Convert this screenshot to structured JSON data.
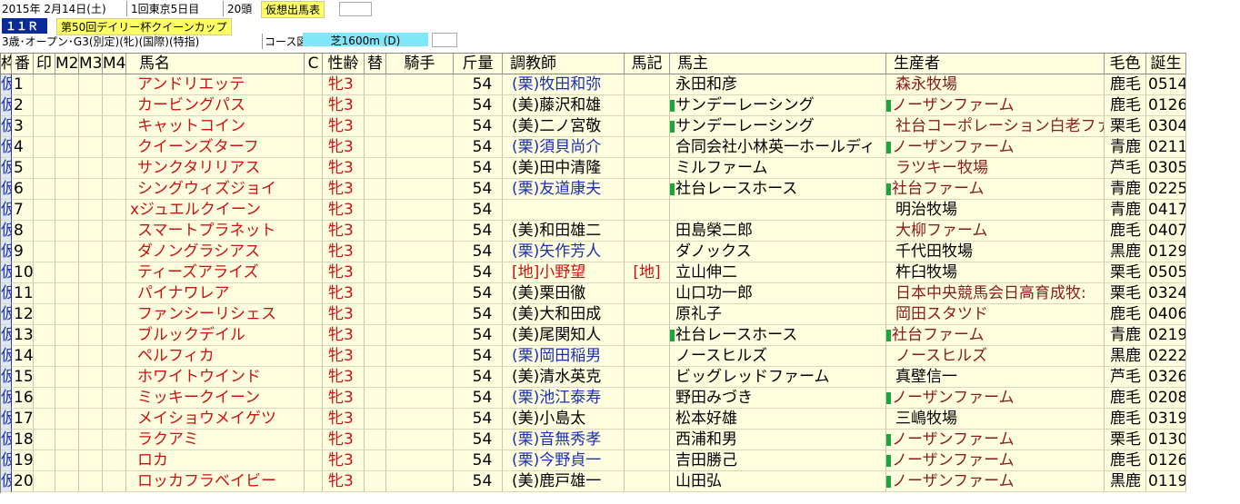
{
  "header": {
    "date": "2015年 2月14日(土)",
    "meeting": "1回東京5日目",
    "runners": "20頭",
    "mode_button": "仮想出馬表",
    "race_no": "１１Ｒ",
    "race_name": "第50回デイリー杯クイーンカップ",
    "conditions": "3歳･オープン･G3(別定)(牝)(国際)(特指)",
    "course_label": "コース図",
    "course": "芝1600m (D)"
  },
  "columns": [
    "枠",
    "番",
    "印",
    "M2",
    "M3",
    "M4",
    "馬名",
    "C",
    "性齢",
    "替",
    "騎手",
    "斤量",
    "調教師",
    "馬記",
    "馬主",
    "生産者",
    "毛色",
    "誕生"
  ],
  "colors": {
    "grid_bg": "#ffffe0",
    "female": "#cc1111",
    "ritto": "#1b2fb0",
    "mark_green": "#19a63a"
  },
  "rows": [
    {
      "waku": "仮",
      "no": "1",
      "name": "アンドリエッテ",
      "sex": "牝3",
      "weight": "54",
      "trainer": "(栗)牧田和弥",
      "trainer_c": "blu",
      "owner": "永田和彦",
      "owner_mark": false,
      "breeder": "森永牧場",
      "breeder_mark": false,
      "breeder_c": "brn",
      "coat": "鹿毛",
      "birth": "0514"
    },
    {
      "waku": "仮",
      "no": "2",
      "name": "カービングパス",
      "sex": "牝3",
      "weight": "54",
      "trainer": "(美)藤沢和雄",
      "trainer_c": "",
      "owner": "サンデーレーシング",
      "owner_mark": true,
      "breeder": "ノーザンファーム",
      "breeder_mark": true,
      "breeder_c": "brn",
      "coat": "鹿毛",
      "birth": "0126"
    },
    {
      "waku": "仮",
      "no": "3",
      "name": "キャットコイン",
      "sex": "牝3",
      "weight": "54",
      "trainer": "(美)二ノ宮敬",
      "trainer_c": "",
      "owner": "サンデーレーシング",
      "owner_mark": true,
      "breeder": "社台コーポレーション白老ファー",
      "breeder_mark": false,
      "breeder_c": "brn",
      "coat": "栗毛",
      "birth": "0304"
    },
    {
      "waku": "仮",
      "no": "4",
      "name": "クイーンズターフ",
      "sex": "牝3",
      "weight": "54",
      "trainer": "(栗)須貝尚介",
      "trainer_c": "blu",
      "owner": "合同会社小林英一ホールディ",
      "owner_mark": false,
      "breeder": "ノーザンファーム",
      "breeder_mark": true,
      "breeder_c": "brn",
      "coat": "青鹿",
      "birth": "0211"
    },
    {
      "waku": "仮",
      "no": "5",
      "name": "サンクタリリアス",
      "sex": "牝3",
      "weight": "54",
      "trainer": "(美)田中清隆",
      "trainer_c": "",
      "owner": "ミルファーム",
      "owner_mark": false,
      "breeder": "ラツキー牧場",
      "breeder_mark": false,
      "breeder_c": "brn",
      "coat": "芦毛",
      "birth": "0305"
    },
    {
      "waku": "仮",
      "no": "6",
      "name": "シングウィズジョイ",
      "sex": "牝3",
      "weight": "54",
      "trainer": "(栗)友道康夫",
      "trainer_c": "blu",
      "owner": "社台レースホース",
      "owner_mark": true,
      "breeder": "社台ファーム",
      "breeder_mark": true,
      "breeder_c": "brn",
      "coat": "青鹿",
      "birth": "0225"
    },
    {
      "waku": "仮",
      "no": "7",
      "name": "xジュエルクイーン",
      "sex": "牝3",
      "weight": "54",
      "trainer": "",
      "trainer_c": "",
      "owner": "",
      "owner_mark": false,
      "breeder": "明治牧場",
      "breeder_mark": false,
      "breeder_c": "",
      "coat": "青鹿",
      "birth": "0417"
    },
    {
      "waku": "仮",
      "no": "8",
      "name": "スマートプラネット",
      "sex": "牝3",
      "weight": "54",
      "trainer": "(美)和田雄二",
      "trainer_c": "",
      "owner": "田島榮二郎",
      "owner_mark": false,
      "breeder": "大柳ファーム",
      "breeder_mark": false,
      "breeder_c": "brn",
      "coat": "鹿毛",
      "birth": "0407"
    },
    {
      "waku": "仮",
      "no": "9",
      "name": "ダノングラシアス",
      "sex": "牝3",
      "weight": "54",
      "trainer": "(栗)矢作芳人",
      "trainer_c": "blu",
      "owner": "ダノックス",
      "owner_mark": false,
      "breeder": "千代田牧場",
      "breeder_mark": false,
      "breeder_c": "",
      "coat": "黒鹿",
      "birth": "0129"
    },
    {
      "waku": "仮",
      "no": "10",
      "name": "ティーズアライズ",
      "sex": "牝3",
      "weight": "54",
      "trainer": "[地]小野望",
      "trainer_c": "red",
      "owner": "立山伸二",
      "owner_mark": false,
      "breeder": "杵臼牧場",
      "breeder_mark": false,
      "breeder_c": "",
      "coat": "栗毛",
      "birth": "0505",
      "umaki": "[地]"
    },
    {
      "waku": "仮",
      "no": "11",
      "name": "パイナワレア",
      "sex": "牝3",
      "weight": "54",
      "trainer": "(美)栗田徹",
      "trainer_c": "",
      "owner": "山口功一郎",
      "owner_mark": false,
      "breeder": "日本中央競馬会日高育成牧:",
      "breeder_mark": false,
      "breeder_c": "brn",
      "coat": "栗毛",
      "birth": "0324"
    },
    {
      "waku": "仮",
      "no": "12",
      "name": "ファンシーリシェス",
      "sex": "牝3",
      "weight": "54",
      "trainer": "(美)大和田成",
      "trainer_c": "",
      "owner": "原礼子",
      "owner_mark": false,
      "breeder": "岡田スタツド",
      "breeder_mark": false,
      "breeder_c": "brn",
      "coat": "鹿毛",
      "birth": "0406"
    },
    {
      "waku": "仮",
      "no": "13",
      "name": "ブルックデイル",
      "sex": "牝3",
      "weight": "54",
      "trainer": "(美)尾関知人",
      "trainer_c": "",
      "owner": "社台レースホース",
      "owner_mark": true,
      "breeder": "社台ファーム",
      "breeder_mark": true,
      "breeder_c": "brn",
      "coat": "青鹿",
      "birth": "0219"
    },
    {
      "waku": "仮",
      "no": "14",
      "name": "ペルフィカ",
      "sex": "牝3",
      "weight": "54",
      "trainer": "(栗)岡田稲男",
      "trainer_c": "blu",
      "owner": "ノースヒルズ",
      "owner_mark": false,
      "breeder": "ノースヒルズ",
      "breeder_mark": false,
      "breeder_c": "brn",
      "coat": "黒鹿",
      "birth": "0222"
    },
    {
      "waku": "仮",
      "no": "15",
      "name": "ホワイトウインド",
      "sex": "牝3",
      "weight": "54",
      "trainer": "(美)清水英克",
      "trainer_c": "",
      "owner": "ビッグレッドファーム",
      "owner_mark": false,
      "breeder": "真壁信一",
      "breeder_mark": false,
      "breeder_c": "",
      "coat": "芦毛",
      "birth": "0326"
    },
    {
      "waku": "仮",
      "no": "16",
      "name": "ミッキークイーン",
      "sex": "牝3",
      "weight": "54",
      "trainer": "(栗)池江泰寿",
      "trainer_c": "blu",
      "owner": "野田みづき",
      "owner_mark": false,
      "breeder": "ノーザンファーム",
      "breeder_mark": true,
      "breeder_c": "brn",
      "coat": "鹿毛",
      "birth": "0208"
    },
    {
      "waku": "仮",
      "no": "17",
      "name": "メイショウメイゲツ",
      "sex": "牝3",
      "weight": "54",
      "trainer": "(美)小島太",
      "trainer_c": "",
      "owner": "松本好雄",
      "owner_mark": false,
      "breeder": "三嶋牧場",
      "breeder_mark": false,
      "breeder_c": "",
      "coat": "鹿毛",
      "birth": "0319"
    },
    {
      "waku": "仮",
      "no": "18",
      "name": "ラクアミ",
      "sex": "牝3",
      "weight": "54",
      "trainer": "(栗)音無秀孝",
      "trainer_c": "blu",
      "owner": "西浦和男",
      "owner_mark": false,
      "breeder": "ノーザンファーム",
      "breeder_mark": true,
      "breeder_c": "brn",
      "coat": "栗毛",
      "birth": "0130"
    },
    {
      "waku": "仮",
      "no": "19",
      "name": "ロカ",
      "sex": "牝3",
      "weight": "54",
      "trainer": "(栗)今野貞一",
      "trainer_c": "blu",
      "owner": "吉田勝己",
      "owner_mark": false,
      "breeder": "ノーザンファーム",
      "breeder_mark": true,
      "breeder_c": "brn",
      "coat": "鹿毛",
      "birth": "0126"
    },
    {
      "waku": "仮",
      "no": "20",
      "name": "ロッカフラベイビー",
      "sex": "牝3",
      "weight": "54",
      "trainer": "(美)鹿戸雄一",
      "trainer_c": "",
      "owner": "山田弘",
      "owner_mark": false,
      "breeder": "ノーザンファーム",
      "breeder_mark": true,
      "breeder_c": "brn",
      "coat": "黒鹿",
      "birth": "0119"
    }
  ]
}
